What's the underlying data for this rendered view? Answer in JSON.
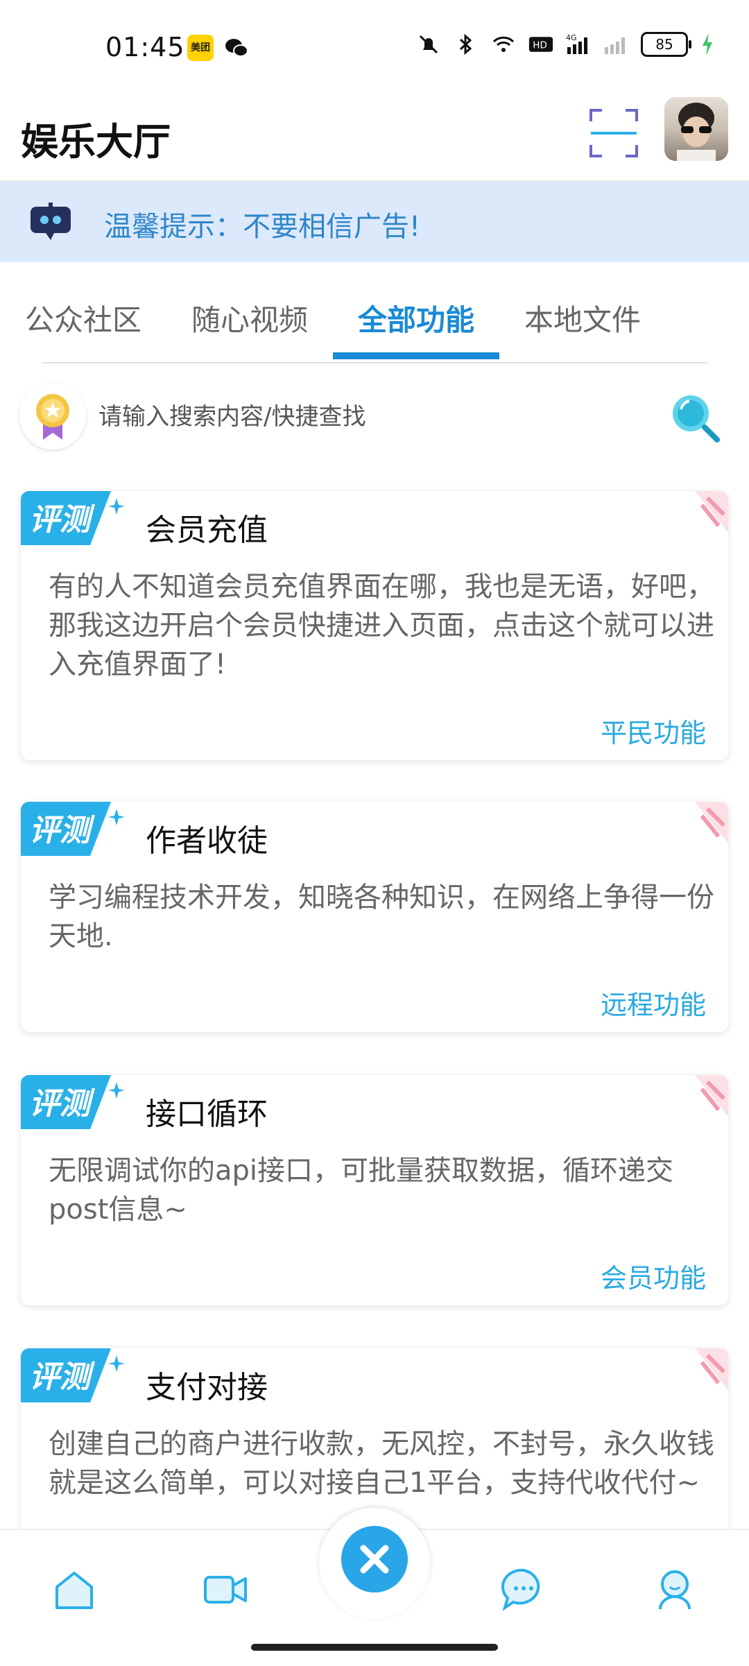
{
  "status_bar": {
    "time": "01:45",
    "meituan_label": "美团",
    "battery": "85",
    "icons": [
      "meituan-icon",
      "wechat-icon",
      "mute-icon",
      "bluetooth-icon",
      "wifi-icon",
      "hd-icon",
      "signal-4g-icon",
      "signal-icon",
      "battery-icon",
      "charging-icon"
    ]
  },
  "header": {
    "title": "娱乐大厅",
    "scan_icon": "scan-icon",
    "avatar": "user-avatar"
  },
  "notice": {
    "text": "温馨提示：不要相信广告!",
    "icon": "robot-icon"
  },
  "tabs": [
    {
      "label": "公众社区",
      "active": false
    },
    {
      "label": "随心视频",
      "active": false
    },
    {
      "label": "全部功能",
      "active": true
    },
    {
      "label": "本地文件",
      "active": false
    }
  ],
  "search": {
    "placeholder": "请输入搜索内容/快捷查找",
    "icon": "search-icon",
    "medal_icon": "medal-icon"
  },
  "badge_text": "评测",
  "cards": [
    {
      "title": "会员充值",
      "desc": "有的人不知道会员充值界面在哪，我也是无语，好吧，那我这边开启个会员快捷进入页面，点击这个就可以进入充值界面了!",
      "tag": "平民功能"
    },
    {
      "title": "作者收徒",
      "desc": "学习编程技术开发，知晓各种知识，在网络上争得一份天地.",
      "tag": "远程功能"
    },
    {
      "title": "接口循环",
      "desc": "无限调试你的api接口，可批量获取数据，循环递交post信息~",
      "tag": "会员功能"
    },
    {
      "title": "支付对接",
      "desc": "创建自己的商户进行收款，无风控，不封号，永久收钱就是这么简单，可以对接自己1平台，支持代收代付~",
      "tag": ""
    }
  ],
  "bottom_nav": {
    "items": [
      "home-icon",
      "video-icon",
      "close-icon",
      "chat-icon",
      "profile-icon"
    ]
  },
  "colors": {
    "accent": "#1a8ad6",
    "notice_bg": "#dce9fb",
    "tag": "#29a9e0",
    "badge": "#2ab0e8"
  }
}
